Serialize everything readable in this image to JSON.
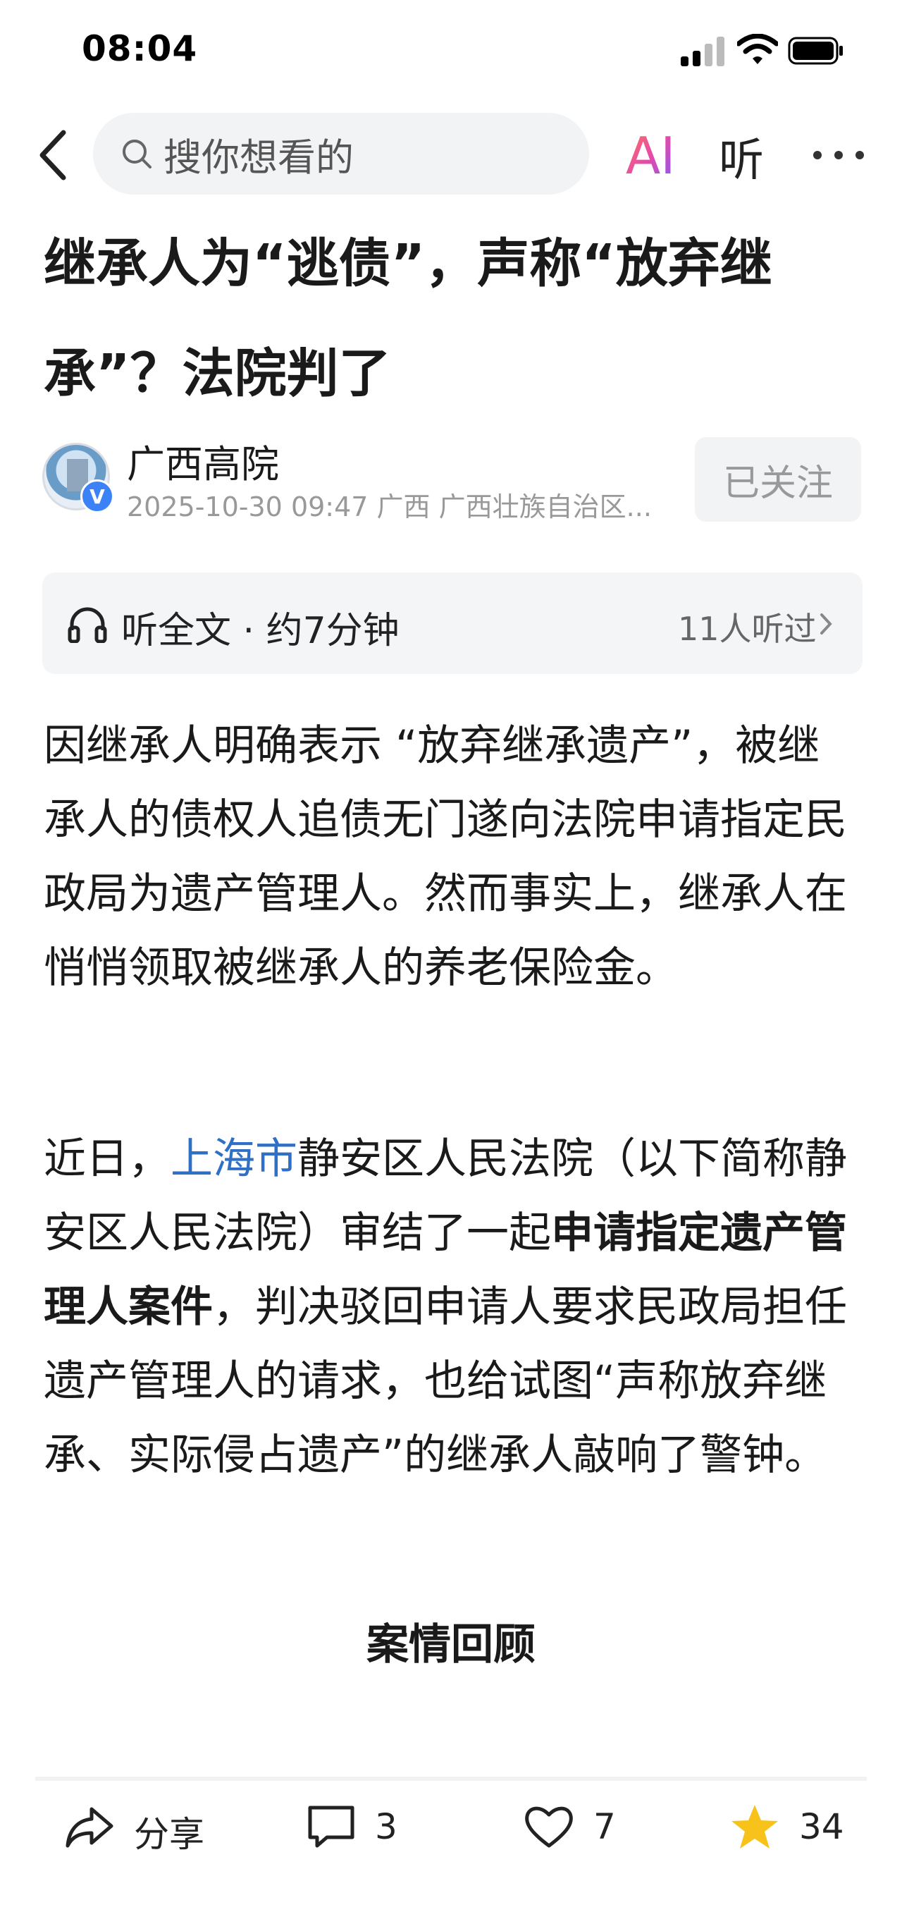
{
  "status_bar": {
    "time": "08:04"
  },
  "nav": {
    "search_placeholder": "搜你想看的",
    "ai_label": "AI",
    "listen_label": "听"
  },
  "article": {
    "title": "继承人为“逃债”，声称“放弃继承”？法院判了",
    "author": {
      "name": "广西高院",
      "badge": "V",
      "date": "2025-10-30",
      "time": "09:47",
      "location": "广西",
      "org": "广西壮族自治区..."
    },
    "follow_label": "已关注",
    "listen_bar": {
      "label": "听全文 · 约7分钟",
      "count": "11人听过"
    },
    "p1": "因继承人明确表示 “放弃继承遗产”，被继承人的债权人追债无门遂向法院申请指定民政局为遗产管理人。然而事实上，继承人在悄悄领取被继承人的养老保险金。",
    "p2": {
      "prefix": "近日，",
      "link": "上海市",
      "mid": "静安区人民法院（以下简称静安区人民法院）审结了一起",
      "bold": "申请指定遗产管理人案件",
      "suffix": "，判决驳回申请人要求民政局担任遗产管理人的请求，也给试图“声称放弃继承、实际侵占遗产”的继承人敲响了警钟。"
    },
    "section_head": "案情回顾"
  },
  "bottom_bar": {
    "share_label": "分享",
    "comment_count": "3",
    "like_count": "7",
    "favorite_count": "34"
  },
  "colors": {
    "link": "#2f6fc5",
    "star": "#f7c21a",
    "search_bg": "#f2f3f5"
  }
}
